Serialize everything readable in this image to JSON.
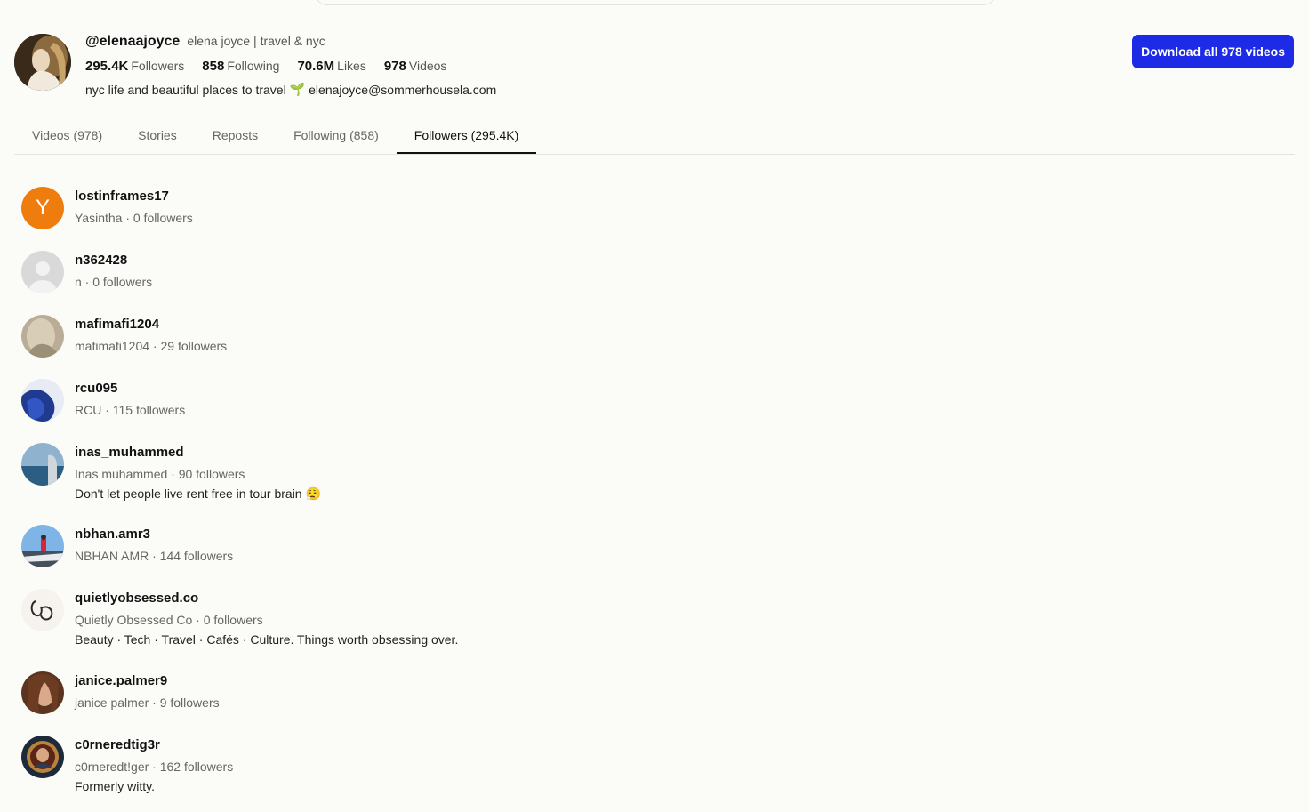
{
  "profile": {
    "handle": "@elenaajoyce",
    "display_name": "elena joyce | travel & nyc",
    "stats": [
      {
        "value": "295.4K",
        "label": "Followers"
      },
      {
        "value": "858",
        "label": "Following"
      },
      {
        "value": "70.6M",
        "label": "Likes"
      },
      {
        "value": "978",
        "label": "Videos"
      }
    ],
    "bio_text": "nyc life and beautiful places to travel",
    "bio_emoji": "🌱",
    "bio_email": "elenajoyce@sommerhousela.com",
    "download_label": "Download all 978 videos"
  },
  "tabs": [
    {
      "label": "Videos (978)"
    },
    {
      "label": "Stories"
    },
    {
      "label": "Reposts"
    },
    {
      "label": "Following (858)"
    },
    {
      "label": "Followers (295.4K)"
    }
  ],
  "active_tab": "Followers (295.4K)",
  "followers": [
    {
      "handle": "lostinframes17",
      "meta": "Yasintha · 0 followers",
      "bio": "",
      "avatar_letter": "Y"
    },
    {
      "handle": "n362428",
      "meta": "n · 0 followers",
      "bio": ""
    },
    {
      "handle": "mafimafi1204",
      "meta": "mafimafi1204 · 29 followers",
      "bio": ""
    },
    {
      "handle": "rcu095",
      "meta": "RCU · 115 followers",
      "bio": ""
    },
    {
      "handle": "inas_muhammed",
      "meta": "Inas muhammed · 90 followers",
      "bio": "Don't let people live rent free in tour brain 😮‍💨"
    },
    {
      "handle": "nbhan.amr3",
      "meta": "NBHAN AMR · 144 followers",
      "bio": ""
    },
    {
      "handle": "quietlyobsessed.co",
      "meta": "Quietly Obsessed Co · 0 followers",
      "bio": "Beauty · Tech · Travel · Cafés · Culture. Things worth obsessing over."
    },
    {
      "handle": "janice.palmer9",
      "meta": "janice palmer · 9 followers",
      "bio": ""
    },
    {
      "handle": "c0rneredtig3r",
      "meta": "c0rneredt!ger · 162 followers",
      "bio": "Formerly witty."
    }
  ],
  "colors": {
    "accent": "#1d2be6",
    "background": "#fbfbf8",
    "letter_avatar": "#ef7d0d"
  }
}
